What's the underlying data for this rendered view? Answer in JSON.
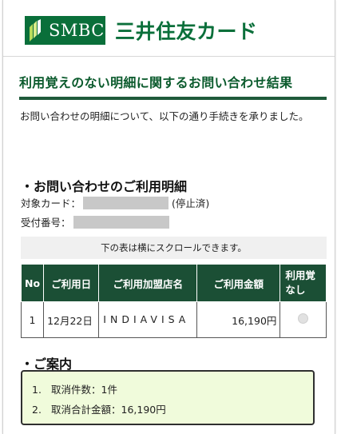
{
  "header": {
    "logo_text": "SMBC",
    "brand_name": "三井住友カード",
    "brand_color": "#0a6f3a"
  },
  "page_title": "利用覚えのない明細に関するお問い合わせ結果",
  "intro_text": "お問い合わせの明細について、以下の通り手続きを承りました。",
  "details_section": {
    "heading": "・お問い合わせのご利用明細",
    "card_label": "対象カード：",
    "card_status": "(停止済)",
    "receipt_label": "受付番号："
  },
  "scroll_note": "下の表は横にスクロールできます。",
  "table": {
    "headers": [
      "No",
      "ご利用日",
      "ご利用加盟店名",
      "ご利用金額",
      "利用覚\nなし"
    ],
    "rows": [
      {
        "no": "1",
        "date": "12月22日",
        "merchant": "INDIAVISA",
        "amount": "16,190円"
      }
    ],
    "header_color": "#1b4f35"
  },
  "guide_section": {
    "heading": "・ご案内",
    "items": [
      {
        "num": "1.",
        "text": "取消件数：1件"
      },
      {
        "num": "2.",
        "text": "取消合計金額：16,190円"
      }
    ],
    "box_color": "#f0fbdb"
  }
}
